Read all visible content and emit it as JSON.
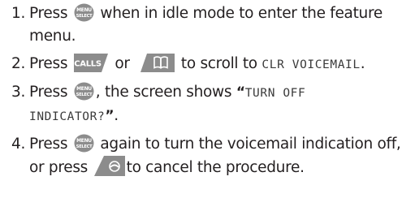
{
  "steps": [
    {
      "number": "1.",
      "before_icon": "Press",
      "icon": "menu-select-icon",
      "after_icon": "when in idle mode to enter the feature menu."
    },
    {
      "number": "2.",
      "before_icon": "Press",
      "icon_1": "calls-icon",
      "calls_icon_label": "CALLS",
      "middle": "or",
      "icon_2": "phonebook-icon",
      "after_icons": "to scroll to",
      "screen_text": "CLR VOICEMAIL",
      "end_punct": "."
    },
    {
      "number": "3.",
      "before_icon": "Press",
      "icon": "menu-select-icon",
      "after_icon": ", the screen shows",
      "open_quote": "“",
      "screen_text_line1": "TURN OFF",
      "screen_text_line2": "INDICATOR?",
      "close_quote": "”",
      "end_punct": "."
    },
    {
      "number": "4.",
      "before_icon": "Press",
      "icon": "menu-select-icon",
      "after_icon": "again to turn the voicemail indication off, or press",
      "icon_2": "end-call-icon",
      "after_icon_2": "to cancel the procedure."
    }
  ],
  "menu_icon_label_top": "MENU",
  "menu_icon_label_bottom": "SELECT",
  "colors": {
    "text": "#231f20",
    "icon_fill": "#8c8c8c",
    "icon_text": "#ffffff"
  }
}
